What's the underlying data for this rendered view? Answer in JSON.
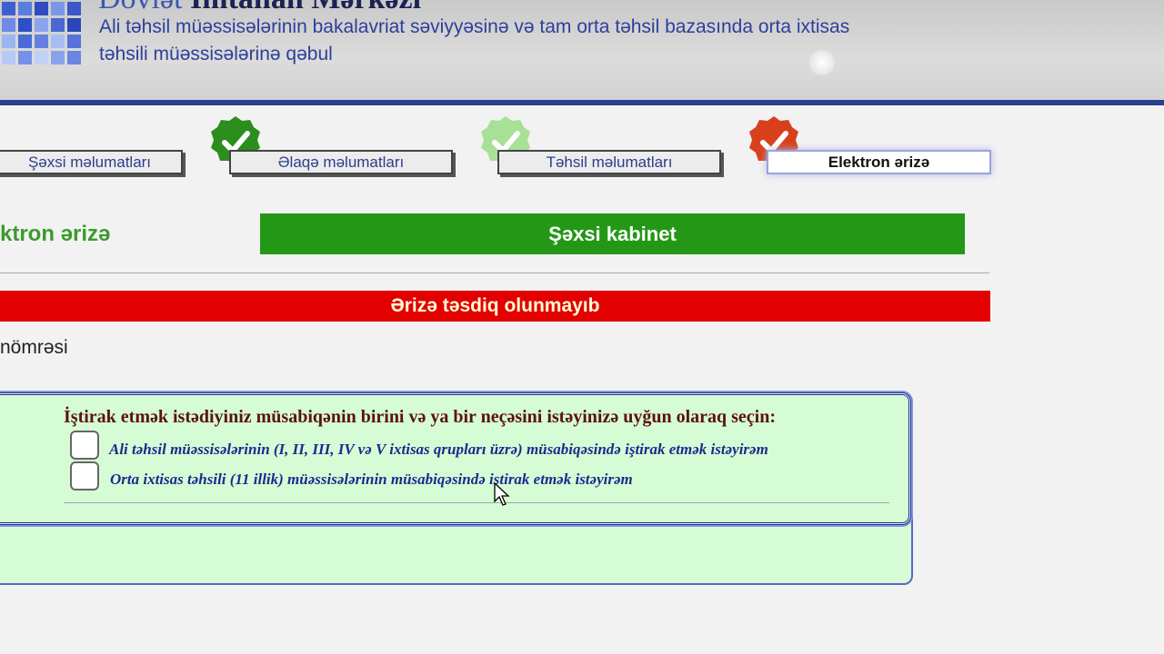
{
  "header": {
    "org_title_part1": "Dövlət",
    "org_title_part2": "İmtahan Mərkəzi",
    "subtitle": "Ali təhsil müəssisələrinin bakalavriat səviyyəsinə və tam orta təhsil bazasında orta ixtisas təhsili müəssisələrinə qəbul",
    "colors": {
      "band": "#d0d0d0",
      "rule": "#2a3f8f",
      "text": "#2d3f9a"
    }
  },
  "steps": [
    {
      "label": "Şəxsi məlumatları",
      "badge": "none"
    },
    {
      "label": "Əlaqə məlumatları",
      "badge": "check-green"
    },
    {
      "label": "Təhsil məlumatları",
      "badge": "check-lightgreen"
    },
    {
      "label": "Elektron ərizə",
      "badge": "check-red",
      "active": true
    }
  ],
  "main": {
    "section_title": "ktron ərizə",
    "cabinet_button": "Şəxsi kabinet",
    "status": "Ərizə təsdiq olunmayıb",
    "field_label": "nömrəsi",
    "colors": {
      "cabinet": "#249816",
      "status": "#e20000",
      "status_text": "#ffffd8"
    }
  },
  "panel": {
    "question": "İştirak etmək istədiyiniz müsabiqənin birini və ya bir neçəsini istəyinizə uyğun olaraq seçin:",
    "options": [
      {
        "label": "Ali təhsil müəssisələrinin (I, II, III, IV və V ixtisas qrupları üzrə) müsabiqəsində iştirak etmək istəyirəm",
        "checked": false
      },
      {
        "label": "Orta ixtisas təhsili (11 illik) müəssisələrinin müsabiqəsində iştirak etmək istəyirəm",
        "checked": false
      }
    ],
    "colors": {
      "background": "#d6fcd6",
      "border": "#1d2d99"
    }
  }
}
